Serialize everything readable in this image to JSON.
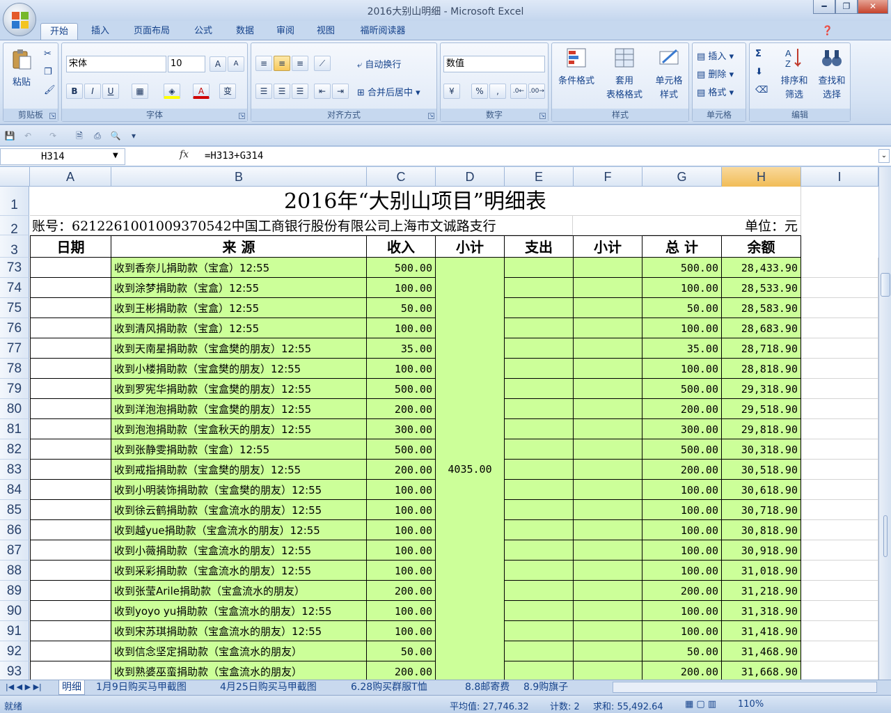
{
  "window": {
    "title": "2016大别山明细 - Microsoft Excel",
    "minimize_glyph": "━",
    "restore_glyph": "❐",
    "close_glyph": "✕"
  },
  "tabs": [
    "开始",
    "插入",
    "页面布局",
    "公式",
    "数据",
    "审阅",
    "视图",
    "福昕阅读器"
  ],
  "ribbon": {
    "clipboard": {
      "paste": "粘贴",
      "label": "剪贴板"
    },
    "font": {
      "name": "宋体",
      "size": "10",
      "label": "字体",
      "bold": "B",
      "italic": "I",
      "underline": "U",
      "grow": "A",
      "shrink": "A",
      "phonetic": "变"
    },
    "alignment": {
      "wrap": "自动换行",
      "merge": "合并后居中",
      "label": "对齐方式"
    },
    "number": {
      "format": "数值",
      "percent": "%",
      "comma": ",",
      "label": "数字"
    },
    "styles": {
      "conditional": "条件格式",
      "table_a": "套用",
      "table_b": "表格格式",
      "cell_a": "单元格",
      "cell_b": "样式",
      "label": "样式"
    },
    "cells": {
      "insert": "插入",
      "delete": "删除",
      "format": "格式",
      "label": "单元格"
    },
    "editing": {
      "sigma": "Σ",
      "sort_a": "排序和",
      "sort_b": "筛选",
      "find_a": "查找和",
      "find_b": "选择",
      "label": "编辑"
    }
  },
  "formula_bar": {
    "name_box": "H314",
    "fx": "fx",
    "formula": "=H313+G314"
  },
  "columns": [
    "A",
    "B",
    "C",
    "D",
    "E",
    "F",
    "G",
    "H",
    "I"
  ],
  "selected_column": "H",
  "sheet": {
    "title": "2016年“大别山项目”明细表",
    "account": "账号：6212261001009370542中国工商银行股份有限公司上海市文诚路支行",
    "unit": "单位：元",
    "headers": [
      "日期",
      "来  源",
      "收入",
      "小计",
      "支出",
      "小计",
      "总  计",
      "余额"
    ],
    "merged_subtotal": "4035.00",
    "rows": [
      {
        "num": "73",
        "source": "收到香奈儿捐助款（宝盒）12:55",
        "income": "500.00",
        "total": "500.00",
        "balance": "28,433.90"
      },
      {
        "num": "74",
        "source": "收到涂梦捐助款（宝盒）12:55",
        "income": "100.00",
        "total": "100.00",
        "balance": "28,533.90"
      },
      {
        "num": "75",
        "source": "收到王彬捐助款（宝盒）12:55",
        "income": "50.00",
        "total": "50.00",
        "balance": "28,583.90"
      },
      {
        "num": "76",
        "source": "收到清风捐助款（宝盒）12:55",
        "income": "100.00",
        "total": "100.00",
        "balance": "28,683.90"
      },
      {
        "num": "77",
        "source": "收到天南星捐助款（宝盒樊的朋友）12:55",
        "income": "35.00",
        "total": "35.00",
        "balance": "28,718.90"
      },
      {
        "num": "78",
        "source": "收到小楼捐助款（宝盒樊的朋友）12:55",
        "income": "100.00",
        "total": "100.00",
        "balance": "28,818.90"
      },
      {
        "num": "79",
        "source": "收到罗宪华捐助款（宝盒樊的朋友）12:55",
        "income": "500.00",
        "total": "500.00",
        "balance": "29,318.90"
      },
      {
        "num": "80",
        "source": "收到洋泡泡捐助款（宝盒樊的朋友）12:55",
        "income": "200.00",
        "total": "200.00",
        "balance": "29,518.90"
      },
      {
        "num": "81",
        "source": "收到泡泡捐助款（宝盒秋天的朋友）12:55",
        "income": "300.00",
        "total": "300.00",
        "balance": "29,818.90"
      },
      {
        "num": "82",
        "source": "收到张静雯捐助款（宝盒）12:55",
        "income": "500.00",
        "total": "500.00",
        "balance": "30,318.90"
      },
      {
        "num": "83",
        "source": "收到戒指捐助款（宝盒樊的朋友）12:55",
        "income": "200.00",
        "total": "200.00",
        "balance": "30,518.90"
      },
      {
        "num": "84",
        "source": "收到小明装饰捐助款（宝盒樊的朋友）12:55",
        "income": "100.00",
        "total": "100.00",
        "balance": "30,618.90"
      },
      {
        "num": "85",
        "source": "收到徐云鹤捐助款（宝盒流水的朋友）12:55",
        "income": "100.00",
        "total": "100.00",
        "balance": "30,718.90"
      },
      {
        "num": "86",
        "source": "收到越yue捐助款（宝盒流水的朋友）12:55",
        "income": "100.00",
        "total": "100.00",
        "balance": "30,818.90"
      },
      {
        "num": "87",
        "source": "收到小薇捐助款（宝盒流水的朋友）12:55",
        "income": "100.00",
        "total": "100.00",
        "balance": "30,918.90"
      },
      {
        "num": "88",
        "source": "收到采彩捐助款（宝盒流水的朋友）12:55",
        "income": "100.00",
        "total": "100.00",
        "balance": "31,018.90"
      },
      {
        "num": "89",
        "source": "收到张莹Arile捐助款（宝盒流水的朋友）",
        "income": "200.00",
        "total": "200.00",
        "balance": "31,218.90"
      },
      {
        "num": "90",
        "source": "收到yoyo yu捐助款（宝盒流水的朋友）12:55",
        "income": "100.00",
        "total": "100.00",
        "balance": "31,318.90"
      },
      {
        "num": "91",
        "source": "收到宋苏琪捐助款（宝盒流水的朋友）12:55",
        "income": "100.00",
        "total": "100.00",
        "balance": "31,418.90"
      },
      {
        "num": "92",
        "source": "收到信念坚定捐助款（宝盒流水的朋友）",
        "income": "50.00",
        "total": "50.00",
        "balance": "31,468.90"
      },
      {
        "num": "93",
        "source": "收到熟婆巫蛮捐助款（宝盒流水的朋友）",
        "income": "200.00",
        "total": "200.00",
        "balance": "31,668.90"
      }
    ]
  },
  "sheet_tabs": [
    "明细",
    "1月9日购买马甲截图",
    "4月25日购买马甲截图",
    "6.28购买群服T恤",
    "8.8邮寄费",
    "8.9购旗子"
  ],
  "status": {
    "ready": "就绪",
    "average": "平均值: 27,746.32",
    "count": "计数: 2",
    "sum": "求和: 55,492.64",
    "zoom": "110%"
  },
  "colors": {
    "accent": "#15428b",
    "green_fill": "#ccff99",
    "selected_header": "#f1bc57"
  }
}
